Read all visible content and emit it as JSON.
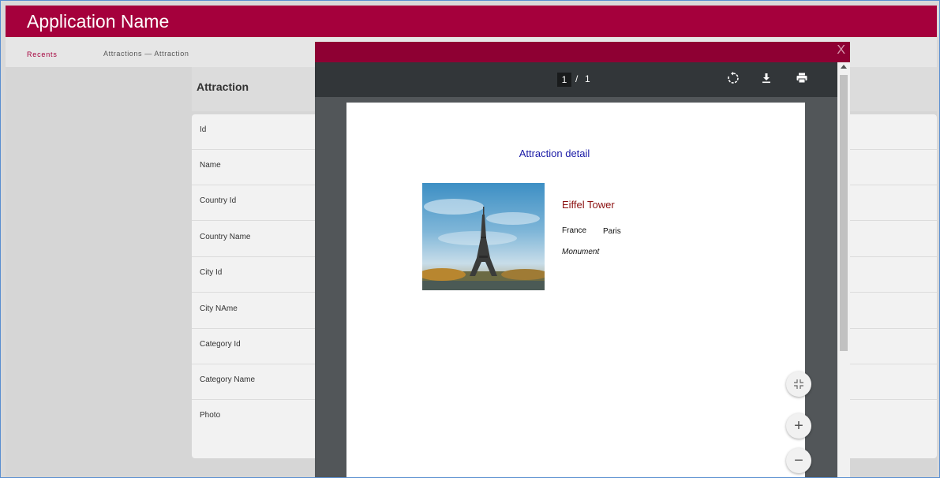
{
  "app": {
    "title": "Application Name"
  },
  "breadcrumb": {
    "recents": "Recents",
    "path": "Attractions — Attraction"
  },
  "form": {
    "title": "Attraction",
    "fields": [
      "Id",
      "Name",
      "Country Id",
      "Country Name",
      "City Id",
      "City NAme",
      "Category Id",
      "Category Name",
      "Photo"
    ]
  },
  "modal": {
    "close_label": "X",
    "viewer": {
      "page_current": "1",
      "page_separator": "/",
      "page_total": "1",
      "icons": {
        "rotate": "rotate-icon",
        "download": "download-icon",
        "print": "print-icon"
      }
    },
    "document": {
      "heading": "Attraction detail",
      "attraction_name": "Eiffel Tower",
      "country": "France",
      "city": "Paris",
      "category": "Monument"
    },
    "floating_buttons": {
      "fit": "fit-page-icon",
      "zoom_in": "+",
      "zoom_out": "−"
    }
  },
  "colors": {
    "brand": "#a5003c",
    "modal_header": "#8e0033",
    "doc_heading": "#1a1aa6",
    "attraction_name": "#8b0f0f"
  }
}
